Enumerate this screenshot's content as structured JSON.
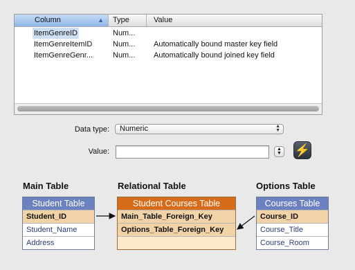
{
  "columns_table": {
    "headers": [
      "Column",
      "Type",
      "Value"
    ],
    "rows": [
      {
        "column": "ItemGenreID",
        "type": "Num...",
        "value": ""
      },
      {
        "column": "ItemGenreItemID",
        "type": "Num...",
        "value": "Automatically bound master key field"
      },
      {
        "column": "ItemGenreGenr...",
        "type": "Num...",
        "value": "Automatically bound joined key field"
      }
    ]
  },
  "form": {
    "data_type_label": "Data type:",
    "data_type_value": "Numeric",
    "value_label": "Value:",
    "value_input": ""
  },
  "diagram": {
    "main": {
      "title": "Main Table",
      "header": "Student Table",
      "rows": [
        "Student_ID",
        "Student_Name",
        "Address"
      ],
      "header_color": "#6c82c0"
    },
    "relational": {
      "title": "Relational Table",
      "header": "Student Courses Table",
      "rows": [
        "Main_Table_Foreign_Key",
        "Options_Table_Foreign_Key"
      ],
      "header_color": "#d66c1a"
    },
    "options": {
      "title": "Options Table",
      "header": "Courses Table",
      "rows": [
        "Course_ID",
        "Course_Title",
        "Course_Room"
      ],
      "header_color": "#6c82c0"
    }
  },
  "colors": {
    "key_row": "#f2d3a8",
    "selection": "#cfe0f6",
    "lightning": "#ffd21a"
  }
}
